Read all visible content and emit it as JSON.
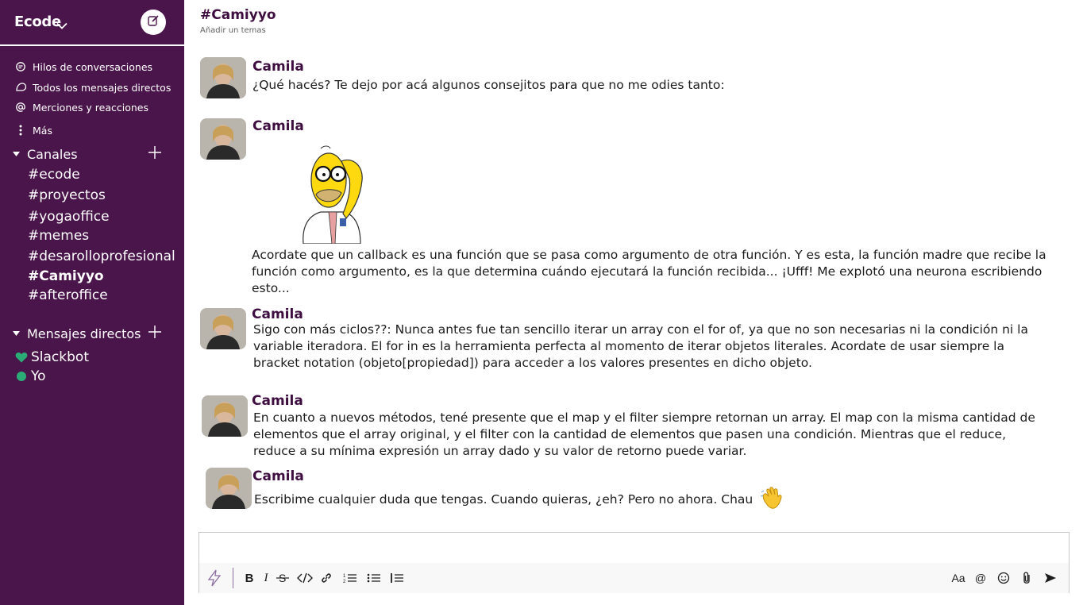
{
  "workspace": {
    "name": "Ecode"
  },
  "nav": [
    {
      "label": "Hilos de conversaciones",
      "icon": "threads-icon"
    },
    {
      "label": "Todos los mensajes directos",
      "icon": "dms-icon"
    },
    {
      "label": "Merciones y reacciones",
      "icon": "at-icon"
    },
    {
      "label": "Más",
      "icon": "more-icon"
    }
  ],
  "channels_section": {
    "label": "Canales"
  },
  "channels": [
    "#ecode",
    "#proyectos",
    "#yogaoffice",
    "#memes",
    "#desarolloprofesional",
    "#Camiyyo",
    "#afteroffice"
  ],
  "active_channel": "#Camiyyo",
  "dm_section": {
    "label": "Mensajes directos"
  },
  "dms": [
    {
      "label": "Slackbot",
      "icon": "heart-icon",
      "color": "#2bac76"
    },
    {
      "label": "Yo",
      "icon": "presence-dot-icon",
      "color": "#2bac76"
    }
  ],
  "channel_header": {
    "title": "#Camiyyo",
    "topic": "Añadir un temas"
  },
  "messages": [
    {
      "author": "Camila",
      "text": "¿Qué hacés? Te dejo por acá algunos consejitos para que no me odies tanto:"
    },
    {
      "author": "Camila",
      "text": "Acordate que un callback es una función que se pasa como argumento de otra función. Y es esta, la función madre que recibe la función como argumento, es la que determina cuándo ejecutará la función recibida... ¡Ufff! Me explotó una neurona escribiendo esto..."
    },
    {
      "author": "Camila",
      "text": "Sigo con más ciclos??: Nunca antes fue tan sencillo iterar un array con el for of, ya que no son necesarias ni la condición ni la variable iteradora. El for in es la herramienta perfecta al momento de iterar objetos literales. Acordate de usar siempre la bracket notation (objeto[propiedad]) para acceder a los valores presentes en dicho objeto."
    },
    {
      "author": "Camila",
      "text": "En cuanto a nuevos métodos, tené presente que el map y el filter siempre retornan un array. El map con la misma cantidad de elementos que el array original, y el filter con la cantidad de elementos que pasen una condición. Mientras que el reduce, reduce a su mínima expresión un array dado y su valor de retorno puede variar."
    },
    {
      "author": "Camila",
      "text": "Escribime cualquier duda que tengas. Cuando quieras, ¿eh? Pero no ahora. Chau",
      "emoji": "waving-hand-icon"
    }
  ],
  "composer": {
    "placeholder": "",
    "toolbar_left": [
      "shortcuts-icon",
      "bold-icon",
      "italic-icon",
      "strikethrough-icon",
      "code-icon",
      "link-icon",
      "ordered-list-icon",
      "bulleted-list-icon",
      "blockquote-icon"
    ],
    "toolbar_right": [
      "text-format-icon",
      "mention-icon",
      "emoji-icon",
      "attach-icon",
      "send-icon"
    ],
    "text_format_label": "Aa",
    "mention_label": "@",
    "bold_label": "B",
    "italic_label": "I"
  },
  "colors": {
    "sidebar": "#4a154b",
    "accent": "#3f0e40",
    "presence": "#2bac76"
  }
}
